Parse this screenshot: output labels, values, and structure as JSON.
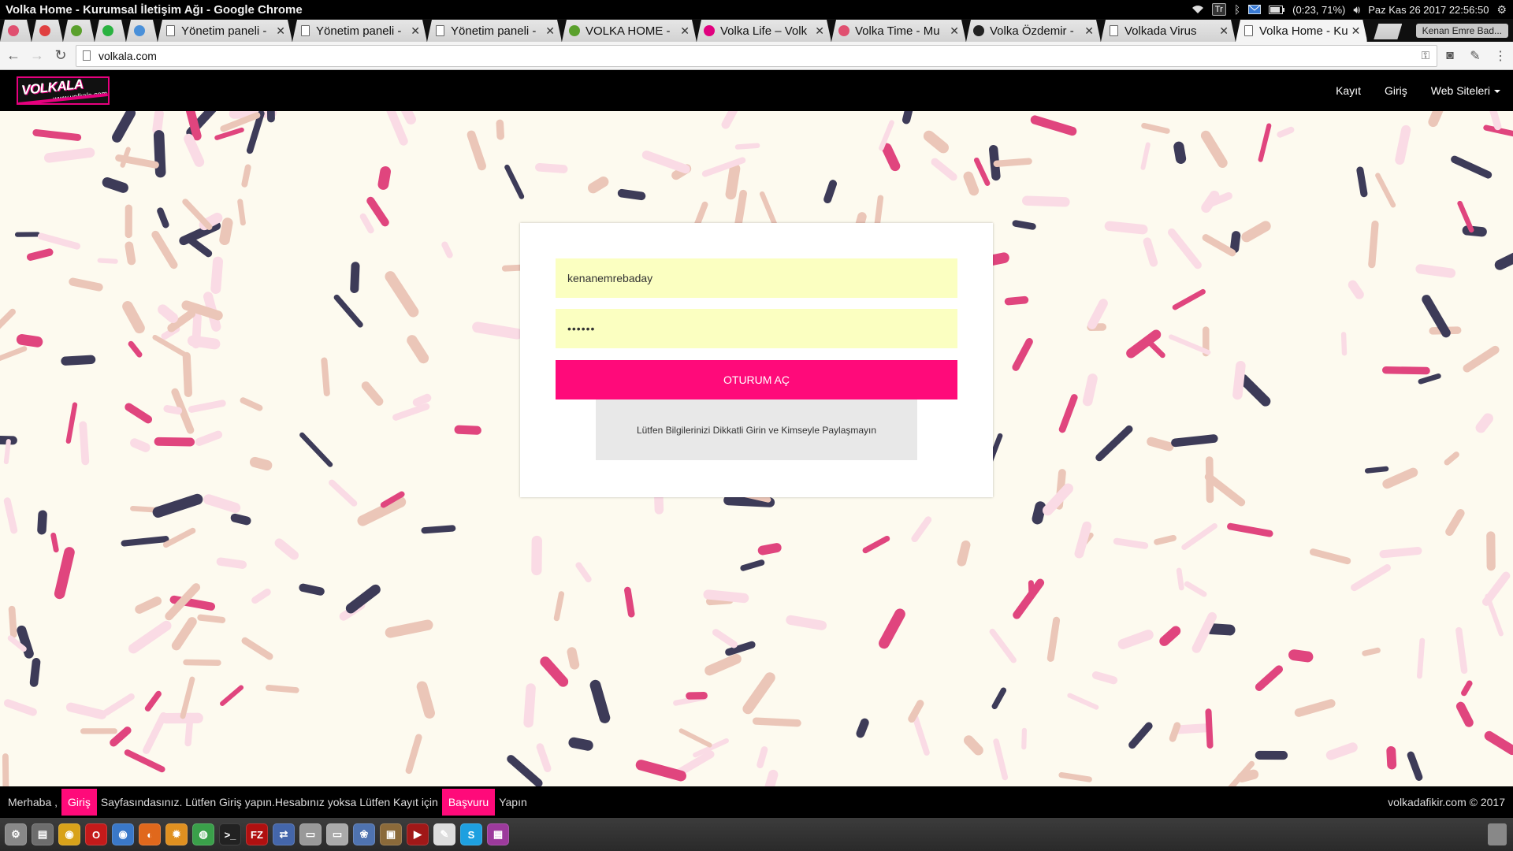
{
  "os": {
    "window_title": "Volka Home - Kurumsal İletişim Ağı - Google Chrome",
    "keyboard_layout": "Tr",
    "battery": "(0:23, 71%)",
    "clock": "Paz Kas 26 2017 22:56:50"
  },
  "tabs": [
    {
      "type": "pinned",
      "title": "",
      "icon": "volka-pinned-icon",
      "color": "#e05070"
    },
    {
      "type": "pinned",
      "title": "",
      "icon": "notification-badge-icon",
      "color": "#e04040"
    },
    {
      "type": "pinned",
      "title": "",
      "icon": "iki-icon",
      "color": "#5aa02c"
    },
    {
      "type": "pinned",
      "title": "",
      "icon": "whatsapp-icon",
      "color": "#2ab240"
    },
    {
      "type": "pinned",
      "title": "",
      "icon": "puzzle-icon",
      "color": "#4a90d9"
    },
    {
      "type": "normal",
      "title": "Yönetim paneli -",
      "icon": "page-icon"
    },
    {
      "type": "normal",
      "title": "Yönetim paneli -",
      "icon": "page-icon"
    },
    {
      "type": "normal",
      "title": "Yönetim paneli -",
      "icon": "page-icon"
    },
    {
      "type": "normal",
      "title": "VOLKA HOME -",
      "icon": "iki-icon"
    },
    {
      "type": "normal",
      "title": "Volka Life – Volk",
      "icon": "volka-life-icon"
    },
    {
      "type": "normal",
      "title": "Volka Time - Mu",
      "icon": "volka-time-icon"
    },
    {
      "type": "normal",
      "title": "Volka Özdemir -",
      "icon": "dark-square-icon"
    },
    {
      "type": "normal",
      "title": "Volkada Virus",
      "icon": "page-icon"
    },
    {
      "type": "active",
      "title": "Volka Home - Ku",
      "icon": "page-icon"
    }
  ],
  "profile_name": "Kenan Emre Bad...",
  "address_bar": {
    "url": "volkala.com"
  },
  "site_nav": {
    "logo_text": "VOLKALA",
    "logo_sub": "www.volkala.com",
    "links": [
      "Kayıt",
      "Giriş"
    ],
    "dropdown_label": "Web Siteleri"
  },
  "login": {
    "username_value": "kenanemrebaday",
    "password_value": "••••••",
    "button_label": "OTURUM AÇ",
    "notice": "Lütfen Bilgilerinizi Dikkatli Girin ve Kimseyle Paylaşmayın"
  },
  "footer": {
    "part1": "Merhaba ,",
    "highlight1": "Giriş",
    "part2": "Sayfasındasınız. Lütfen Giriş yapın.Hesabınız yoksa Lütfen Kayıt için",
    "highlight2": "Başvuru",
    "part3": "Yapın",
    "copyright": "volkadafikir.com © 2017"
  },
  "colors": {
    "accent": "#ff0a7a",
    "field_bg": "#fbffc1",
    "page_bg": "#fdfaef",
    "sprinkle_dark": "#3d3b58",
    "sprinkle_pink": "#e0457e",
    "sprinkle_light_pink": "#fadbe5",
    "sprinkle_beige": "#ebc6b8"
  },
  "dock_apps": [
    {
      "name": "system-settings-icon",
      "color": "#888888",
      "label": "⚙"
    },
    {
      "name": "file-manager-icon",
      "color": "#6d6d6d",
      "label": "▤"
    },
    {
      "name": "chrome-icon",
      "color": "#d8a21a",
      "label": "◉"
    },
    {
      "name": "opera-icon",
      "color": "#c41a1a",
      "label": "O"
    },
    {
      "name": "chromium-icon",
      "color": "#3a78c8",
      "label": "◉"
    },
    {
      "name": "firefox-icon",
      "color": "#e0681c",
      "label": "◐"
    },
    {
      "name": "gear-icon",
      "color": "#e09020",
      "label": "✹"
    },
    {
      "name": "chat-icon",
      "color": "#3aa04a",
      "label": "◍"
    },
    {
      "name": "terminal-icon",
      "color": "#222222",
      "label": ">_"
    },
    {
      "name": "filezilla-icon",
      "color": "#b01010",
      "label": "FZ"
    },
    {
      "name": "network-icon",
      "color": "#4466aa",
      "label": "⇄"
    },
    {
      "name": "drive-icon",
      "color": "#999999",
      "label": "▭"
    },
    {
      "name": "disk-icon",
      "color": "#aaaaaa",
      "label": "▭"
    },
    {
      "name": "gimp-icon",
      "color": "#4f73b0",
      "label": "❀"
    },
    {
      "name": "media-icon",
      "color": "#8b6a3a",
      "label": "▣"
    },
    {
      "name": "video-icon",
      "color": "#a01818",
      "label": "▶"
    },
    {
      "name": "text-editor-icon",
      "color": "#dddddd",
      "label": "✎"
    },
    {
      "name": "skype-icon",
      "color": "#1ea0e0",
      "label": "S"
    },
    {
      "name": "window-icon",
      "color": "#9c3a9c",
      "label": "▦"
    }
  ]
}
